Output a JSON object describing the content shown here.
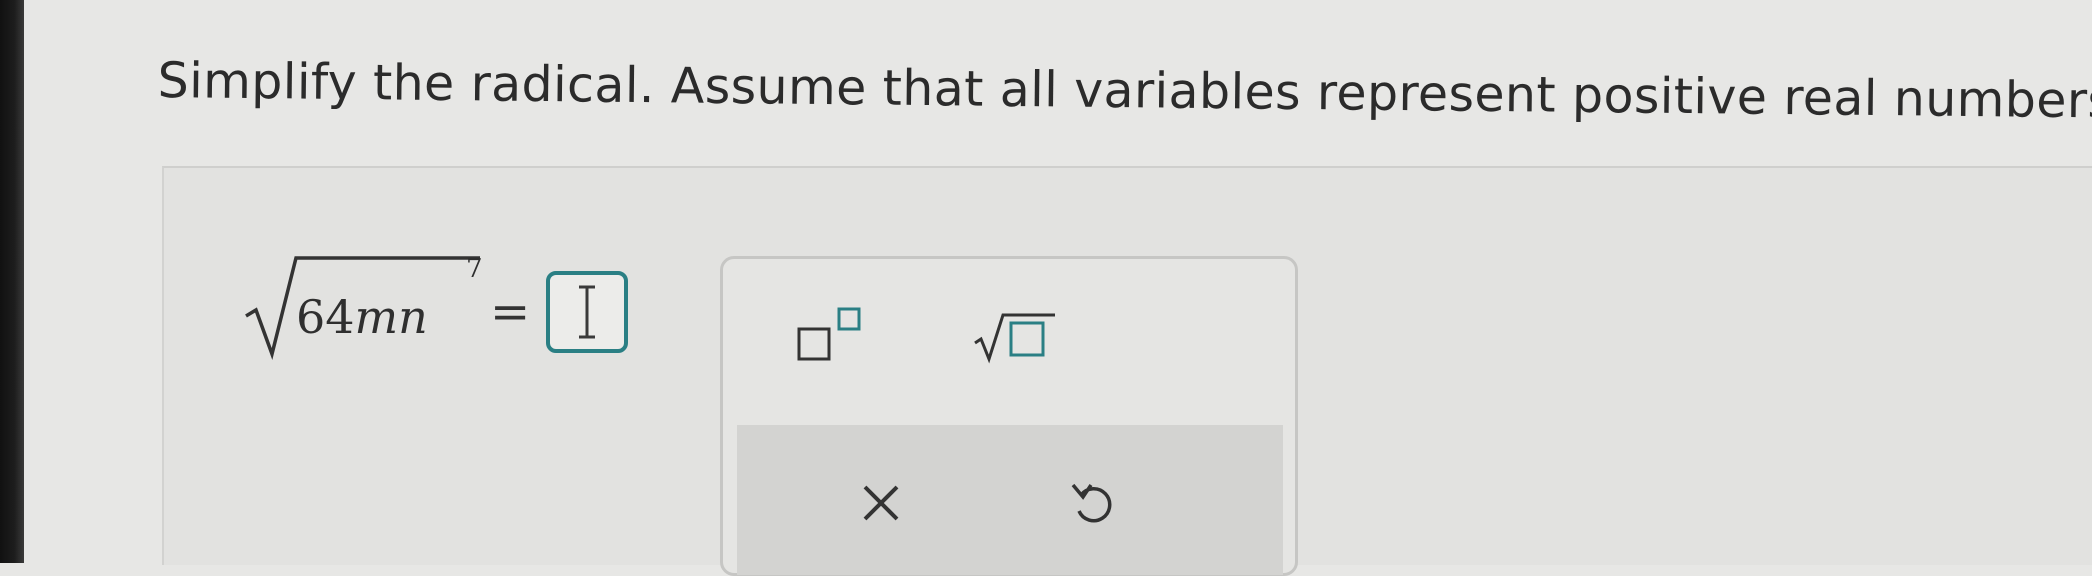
{
  "question": {
    "text": "Simplify the radical. Assume that all variables represent positive real numbers."
  },
  "expression": {
    "coefficient": "64",
    "var_m": "m",
    "var_n": "n",
    "exponent": "7",
    "equals": "="
  },
  "answer": {
    "value": ""
  },
  "palette": {
    "buttons": [
      {
        "name": "exponent-button",
        "icon": "exponent-template-icon"
      },
      {
        "name": "square-root-button",
        "icon": "sqrt-template-icon"
      }
    ],
    "actions": [
      {
        "name": "clear-button",
        "icon": "x-icon"
      },
      {
        "name": "undo-button",
        "icon": "undo-icon"
      }
    ]
  },
  "colors": {
    "accent": "#2a7f84",
    "background": "#e7e7e5",
    "text": "#2b2b2b"
  }
}
